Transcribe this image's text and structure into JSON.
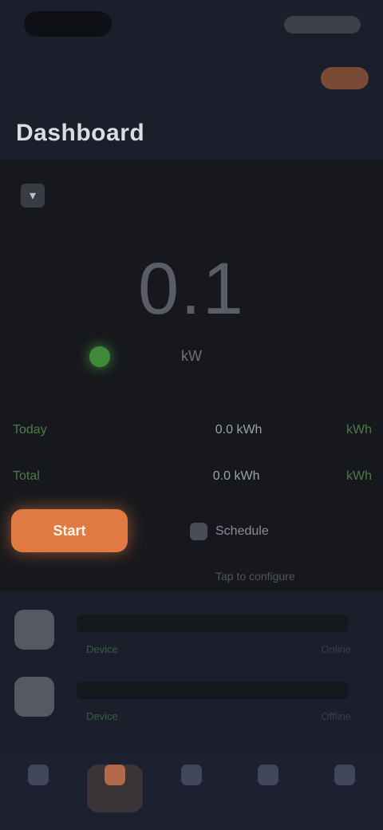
{
  "status": {
    "time": "",
    "indicators": ""
  },
  "header": {
    "action_label": ""
  },
  "title": "Dashboard",
  "display": {
    "value": "0.1",
    "label": "kW",
    "status_color": "#3f8a3a"
  },
  "stats": [
    [
      "Today",
      "",
      "0.0 kWh",
      "kWh"
    ],
    [
      "Total",
      "",
      "0.0 kWh",
      "kWh"
    ]
  ],
  "actions": {
    "primary": "Start",
    "secondary": "Schedule",
    "hint": "Tap to configure"
  },
  "list": [
    {
      "meta": "Device",
      "time": "Online"
    },
    {
      "meta": "Device",
      "time": "Offline"
    }
  ],
  "nav": [
    {
      "label": ""
    },
    {
      "label": ""
    },
    {
      "label": ""
    },
    {
      "label": ""
    },
    {
      "label": ""
    }
  ],
  "colors": {
    "accent": "#e07a42",
    "background": "#1b1f2b",
    "panel": "#17181d",
    "ok": "#3f8a3a"
  },
  "icons": [
    "collapse-icon",
    "calendar-icon",
    "home-icon",
    "bolt-icon",
    "chart-icon",
    "star-icon",
    "user-icon"
  ]
}
